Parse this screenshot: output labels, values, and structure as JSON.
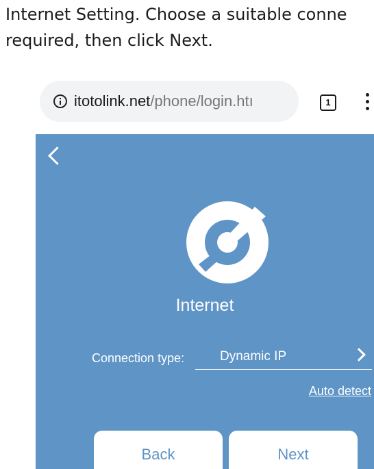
{
  "instruction": {
    "line1": "Internet Setting. Choose a suitable conne",
    "line2": "required, then click Next."
  },
  "browser": {
    "url_host": "itotolink.net",
    "url_path": "/phone/login.htı",
    "tab_count": "1"
  },
  "app": {
    "title": "Internet",
    "connection_type_label": "Connection type:",
    "connection_type_value": "Dynamic IP",
    "auto_detect_label": "Auto detect",
    "back_button": "Back",
    "next_button": "Next",
    "colors": {
      "background": "#5e94c6",
      "button_text": "#5e94c6",
      "foreground": "#ffffff"
    }
  },
  "icons": [
    "info-icon",
    "tab-switcher-icon",
    "more-vert-icon",
    "back-arrow-icon",
    "internet-logo-icon",
    "chevron-right-icon"
  ]
}
